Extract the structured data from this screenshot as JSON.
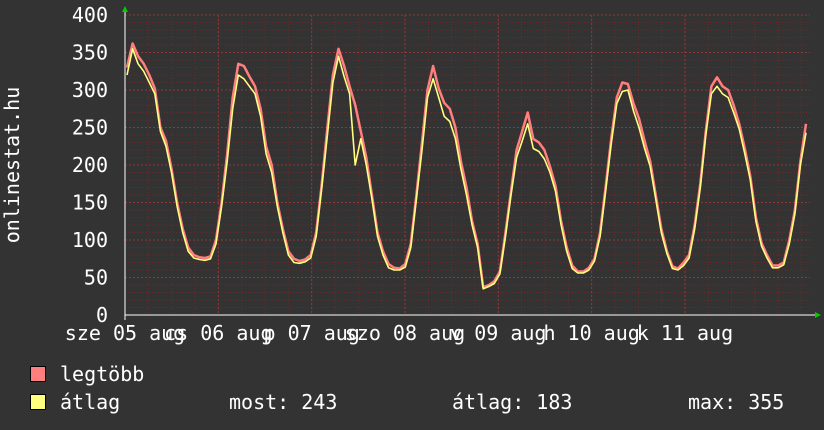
{
  "chart_data": {
    "type": "line",
    "ylabel": "onlinestat.hu",
    "ylim": [
      0,
      400
    ],
    "yticks": [
      0,
      50,
      100,
      150,
      200,
      250,
      300,
      350,
      400
    ],
    "x_labels": [
      "sze 05 aug",
      "cs 06 aug",
      "p 07 aug",
      "szo 08 aug",
      "v 09 aug",
      "h 10 aug",
      "k 11 aug"
    ],
    "grid": true,
    "series": [
      {
        "name": "legtöbb",
        "color": "#ff7f7f",
        "values": [
          330,
          362,
          345,
          335,
          320,
          302,
          250,
          232,
          195,
          150,
          115,
          90,
          80,
          77,
          76,
          78,
          100,
          150,
          215,
          290,
          335,
          332,
          318,
          305,
          275,
          225,
          200,
          150,
          115,
          85,
          75,
          72,
          74,
          80,
          110,
          175,
          250,
          320,
          355,
          332,
          305,
          280,
          245,
          210,
          160,
          110,
          85,
          68,
          63,
          62,
          68,
          95,
          160,
          230,
          300,
          332,
          302,
          283,
          275,
          250,
          205,
          170,
          125,
          95,
          37,
          40,
          45,
          58,
          110,
          165,
          220,
          245,
          270,
          235,
          230,
          220,
          198,
          172,
          125,
          90,
          66,
          58,
          58,
          63,
          75,
          110,
          170,
          235,
          290,
          310,
          308,
          282,
          262,
          232,
          205,
          160,
          115,
          85,
          65,
          62,
          70,
          80,
          120,
          175,
          245,
          305,
          317,
          305,
          300,
          280,
          255,
          222,
          185,
          130,
          96,
          80,
          66,
          66,
          70,
          100,
          140,
          205,
          255
        ]
      },
      {
        "name": "átlag",
        "color": "#ffff7f",
        "values": [
          320,
          355,
          335,
          325,
          310,
          295,
          245,
          225,
          190,
          145,
          110,
          85,
          76,
          74,
          73,
          75,
          95,
          145,
          205,
          275,
          320,
          315,
          305,
          295,
          265,
          215,
          190,
          145,
          110,
          80,
          70,
          69,
          71,
          76,
          105,
          170,
          240,
          310,
          345,
          318,
          295,
          200,
          235,
          200,
          155,
          105,
          80,
          63,
          60,
          60,
          64,
          90,
          155,
          220,
          290,
          315,
          290,
          265,
          258,
          235,
          195,
          160,
          120,
          90,
          35,
          38,
          42,
          55,
          105,
          160,
          210,
          232,
          255,
          222,
          218,
          208,
          190,
          165,
          120,
          85,
          62,
          56,
          56,
          60,
          72,
          105,
          165,
          228,
          282,
          298,
          300,
          272,
          250,
          222,
          198,
          155,
          110,
          82,
          62,
          60,
          66,
          76,
          115,
          170,
          240,
          295,
          305,
          295,
          290,
          270,
          248,
          215,
          180,
          125,
          92,
          76,
          63,
          63,
          67,
          95,
          135,
          200,
          243
        ]
      }
    ]
  },
  "legend": {
    "max_label": "legtöbb",
    "avg_label": "átlag",
    "max_color": "#ff7f7f",
    "avg_color": "#ffff7f"
  },
  "stats": {
    "now": "most: 243",
    "avg": "átlag: 183",
    "max": "max: 355"
  }
}
